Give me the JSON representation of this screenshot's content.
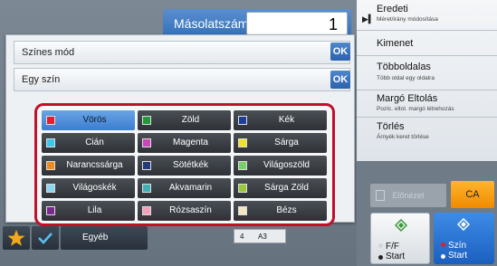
{
  "copy_count": {
    "label": "Másolatszám",
    "value": "1"
  },
  "right_menu": [
    {
      "title": "Eredeti",
      "subtitle": "Méret/irány módosítása"
    },
    {
      "title": "Kimenet",
      "subtitle": ""
    },
    {
      "title": "Többoldalas",
      "subtitle": "Több oldal egy oldalra"
    },
    {
      "title": "Margó Eltolás",
      "subtitle": "Pozíc. eltol. margó létrehozás"
    },
    {
      "title": "Törlés",
      "subtitle": "Árnyék keret törlése"
    }
  ],
  "dialog": {
    "row1_label": "Színes mód",
    "row2_label": "Egy szín",
    "ok_label": "OK"
  },
  "colors": [
    {
      "label": "Vörös",
      "swatch": "#e0202a",
      "selected": true
    },
    {
      "label": "Zöld",
      "swatch": "#1f9a3a",
      "selected": false
    },
    {
      "label": "Kék",
      "swatch": "#1c3f9e",
      "selected": false
    },
    {
      "label": "Cián",
      "swatch": "#3cc8e8",
      "selected": false
    },
    {
      "label": "Magenta",
      "swatch": "#c848b8",
      "selected": false
    },
    {
      "label": "Sárga",
      "swatch": "#f2e12a",
      "selected": false
    },
    {
      "label": "Narancssárga",
      "swatch": "#f08a1c",
      "selected": false
    },
    {
      "label": "Sötétkék",
      "swatch": "#243a7a",
      "selected": false
    },
    {
      "label": "Világoszöld",
      "swatch": "#78d06a",
      "selected": false
    },
    {
      "label": "Világoskék",
      "swatch": "#8fd4f0",
      "selected": false
    },
    {
      "label": "Akvamarin",
      "swatch": "#3fb0b8",
      "selected": false
    },
    {
      "label": "Sárga Zöld",
      "swatch": "#9bc83a",
      "selected": false
    },
    {
      "label": "Lila",
      "swatch": "#7a2a8e",
      "selected": false
    },
    {
      "label": "Rózsaszín",
      "swatch": "#f0a0b8",
      "selected": false
    },
    {
      "label": "Bézs",
      "swatch": "#f2e6c4",
      "selected": false
    }
  ],
  "right_buttons": {
    "disabled_label": "Előnézet",
    "ca_label": "CA",
    "ff_start_l1": "F/F",
    "ff_start_l2": "Start",
    "color_start_l1": "Szín",
    "color_start_l2": "Start"
  },
  "bottom_bar": {
    "other_label": "Egyéb",
    "paper_number": "4",
    "paper_size": "A3"
  },
  "accent_colors": {
    "selection_frame": "#c0102a",
    "ok_blue": "#2a62ad",
    "ca_orange": "#f08a00",
    "start_blue": "#1b5fbf"
  }
}
